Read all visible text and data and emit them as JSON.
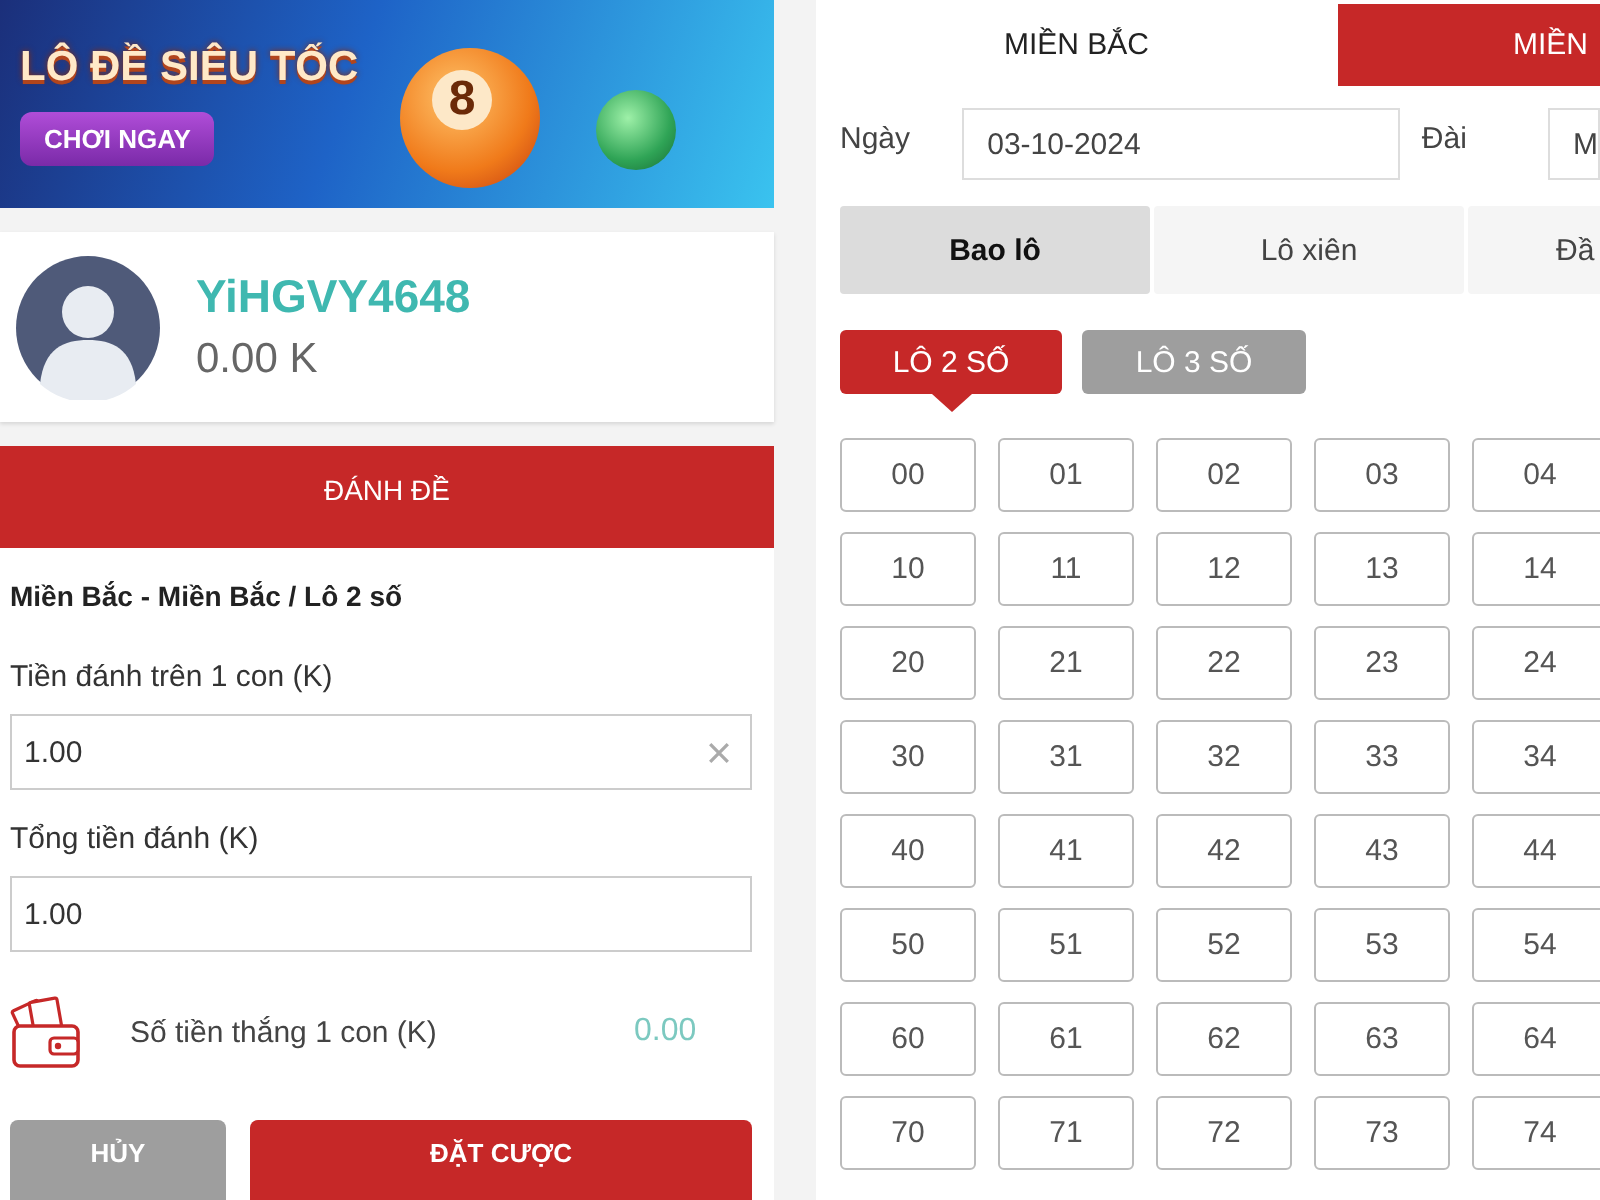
{
  "banner": {
    "title": "LÔ ĐỀ SIÊU TỐC",
    "button": "CHƠI NGAY",
    "ball_number": "8"
  },
  "profile": {
    "username": "YiHGVY4648",
    "balance": "0.00 K"
  },
  "bet_panel": {
    "title": "ĐÁNH ĐỀ",
    "selection": "Miền Bắc - Miền Bắc / Lô 2 số",
    "stake_label": "Tiền đánh trên 1 con (K)",
    "stake_value": "1.00",
    "total_label": "Tổng tiền đánh (K)",
    "total_value": "1.00",
    "win_label": "Số tiền thắng 1 con (K)",
    "win_value": "0.00",
    "buttons": [
      {
        "label": "HỦY",
        "kind": "cancel"
      },
      {
        "label": "ĐẶT CƯỢC",
        "kind": "submit"
      }
    ]
  },
  "region_tabs": [
    {
      "label": "MIỀN BẮC",
      "selected": false
    },
    {
      "label": "MIỀN",
      "selected": true
    }
  ],
  "filters": {
    "date_label": "Ngày",
    "date_value": "03-10-2024",
    "station_label": "Đài",
    "station_value": "M"
  },
  "bet_types": [
    {
      "label": "Bao lô",
      "selected": true
    },
    {
      "label": "Lô xiên",
      "selected": false
    },
    {
      "label": "Đầ",
      "selected": false
    }
  ],
  "digit_modes": [
    {
      "label": "LÔ 2 SỐ",
      "selected": true
    },
    {
      "label": "LÔ 3 SỐ",
      "selected": false
    }
  ],
  "numbers": [
    "00",
    "01",
    "02",
    "03",
    "04",
    "10",
    "11",
    "12",
    "13",
    "14",
    "20",
    "21",
    "22",
    "23",
    "24",
    "30",
    "31",
    "32",
    "33",
    "34",
    "40",
    "41",
    "42",
    "43",
    "44",
    "50",
    "51",
    "52",
    "53",
    "54",
    "60",
    "61",
    "62",
    "63",
    "64",
    "70",
    "71",
    "72",
    "73",
    "74"
  ]
}
